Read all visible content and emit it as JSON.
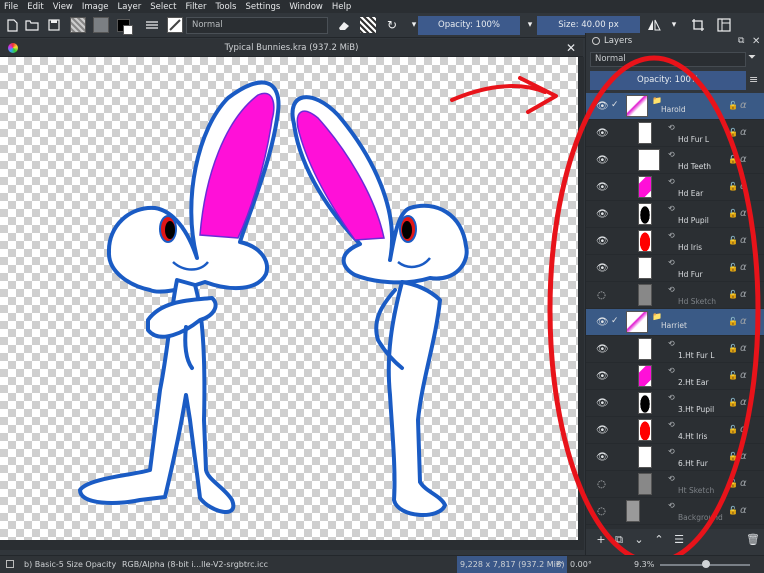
{
  "menu": [
    "File",
    "Edit",
    "View",
    "Image",
    "Layer",
    "Select",
    "Filter",
    "Tools",
    "Settings",
    "Window",
    "Help"
  ],
  "toolbar": {
    "blend_mode": "Normal",
    "opacity_label": "Opacity: 100%",
    "size_label": "Size: 40.00 px"
  },
  "canvas": {
    "title": "Typical Bunnies.kra (937.2 MiB)"
  },
  "layers_docker": {
    "title": "Layers",
    "blend_mode": "Normal",
    "opacity_label": "Opacity: 100%",
    "layers": [
      {
        "name": "Harold",
        "type": "group",
        "visible": true,
        "checked": true,
        "indent": 0,
        "thumb": "pink-sketch"
      },
      {
        "name": "Hd Fur L",
        "type": "paint",
        "visible": true,
        "indent": 1,
        "thumb": "sketch"
      },
      {
        "name": "Hd Teeth",
        "type": "paint",
        "visible": true,
        "indent": 1,
        "thumb": "teeth"
      },
      {
        "name": "Hd Ear",
        "type": "paint",
        "visible": true,
        "indent": 1,
        "thumb": "magenta"
      },
      {
        "name": "Hd Pupil",
        "type": "paint",
        "visible": true,
        "indent": 1,
        "thumb": "black"
      },
      {
        "name": "Hd Iris",
        "type": "paint",
        "visible": true,
        "indent": 1,
        "thumb": "red"
      },
      {
        "name": "Hd Fur",
        "type": "paint",
        "visible": true,
        "indent": 1,
        "thumb": "white"
      },
      {
        "name": "Hd Sketch",
        "type": "paint",
        "visible": false,
        "indent": 1,
        "thumb": "checker"
      },
      {
        "name": "Harriet",
        "type": "group",
        "visible": true,
        "checked": true,
        "indent": 0,
        "thumb": "pink-sketch"
      },
      {
        "name": "1.Ht Fur L",
        "type": "paint",
        "visible": true,
        "indent": 1,
        "thumb": "sketch"
      },
      {
        "name": "2.Ht Ear",
        "type": "paint",
        "visible": true,
        "indent": 1,
        "thumb": "magenta"
      },
      {
        "name": "3.Ht Pupil",
        "type": "paint",
        "visible": true,
        "indent": 1,
        "thumb": "black"
      },
      {
        "name": "4.Ht Iris",
        "type": "paint",
        "visible": true,
        "indent": 1,
        "thumb": "red"
      },
      {
        "name": "6.Ht Fur",
        "type": "paint",
        "visible": true,
        "indent": 1,
        "thumb": "white"
      },
      {
        "name": "Ht Sketch",
        "type": "paint",
        "visible": false,
        "indent": 1,
        "thumb": "checker"
      },
      {
        "name": "Background",
        "type": "paint",
        "visible": false,
        "indent": 0,
        "thumb": "gray"
      }
    ]
  },
  "statusbar": {
    "brush": "b) Basic-5 Size Opacity",
    "color_profile": "RGB/Alpha (8-bit i...lle-V2-srgbtrc.icc",
    "dimensions": "9,228 x 7,817 (937.2 MiB)",
    "rotation": "0.00°",
    "zoom": "9.3%"
  },
  "colors": {
    "accent": "#3b5889",
    "annotation": "#e8131a",
    "ear_pink": "#ff10d8",
    "outline_blue": "#1a5bc4"
  }
}
